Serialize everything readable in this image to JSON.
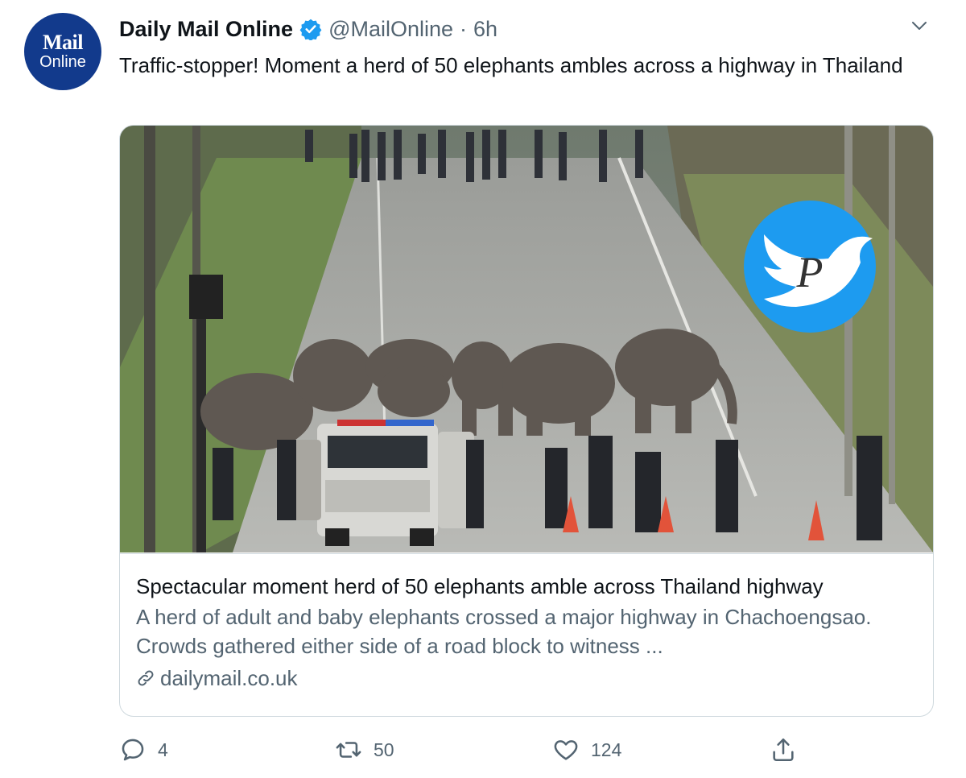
{
  "author": {
    "avatar_line1": "Mail",
    "avatar_line2": "Online",
    "name": "Daily Mail Online",
    "handle": "@MailOnline",
    "separator": "·",
    "time": "6h"
  },
  "tweet": {
    "text": "Traffic-stopper! Moment a herd of 50 elephants ambles across a highway in Thailand"
  },
  "card": {
    "watermark_letter": "P",
    "title": "Spectacular moment herd of 50 elephants amble across Thailand highway",
    "description": "A herd of adult and baby elephants crossed a major highway in Chachoengsao. Crowds gathered either side of a road block to witness ...",
    "domain": "dailymail.co.uk"
  },
  "actions": {
    "reply_count": "4",
    "retweet_count": "50",
    "like_count": "124"
  },
  "icons": {
    "verified": "verified-badge-icon",
    "caret": "chevron-down-icon",
    "link": "link-icon",
    "reply": "reply-icon",
    "retweet": "retweet-icon",
    "like": "heart-icon",
    "share": "share-icon"
  },
  "colors": {
    "verified_blue": "#1d9bf0",
    "avatar_navy": "#123a8c",
    "secondary_text": "#536471"
  }
}
